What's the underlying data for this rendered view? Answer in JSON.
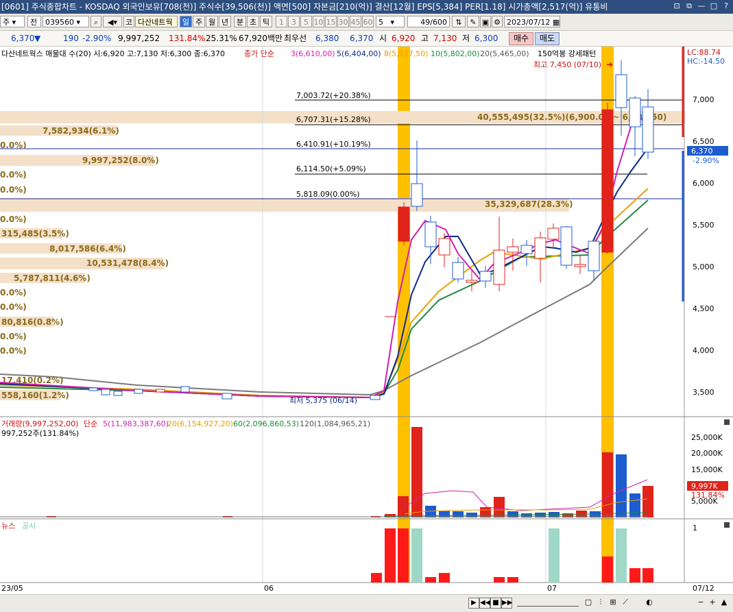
{
  "titlebar": {
    "title": "[0601] 주식종합차트 - KOSDAQ 외국인보유[708(천)] 주식수[39,506(천)] 액면[500] 자본금[210(억)] 결산[12월] EPS[5,384] PER[1.18] 시가총액[2,517(억)] 유통비",
    "buttons": [
      "⊡",
      "⧉",
      "—",
      "□",
      "?"
    ]
  },
  "toolbar": {
    "mode": "주",
    "period_sel": "전",
    "code": "039560",
    "search_icon": "magnifier-icon",
    "c_label": "코",
    "name": "다산네트웍",
    "period_tabs": [
      "일",
      "주",
      "월",
      "년",
      "분",
      "초",
      "틱"
    ],
    "period_selected": "일",
    "minute_options": [
      "1",
      "3",
      "5",
      "10",
      "15",
      "30",
      "45",
      "60"
    ],
    "interval_value": "5",
    "count_value": "49",
    "count_total": "/600",
    "date": "2023/07/12"
  },
  "quote": {
    "price": "6,370",
    "arrow": "▼",
    "change": "190",
    "change_pct": "-2.90%",
    "volume": "9,997,252",
    "vol_ratio": "131.84%",
    "turnover": "25.31%",
    "amount": "67,920백만",
    "pref_label": "최우선",
    "bid": "6,380",
    "ask": "6,370",
    "open_label": "시",
    "open": "6,920",
    "high_label": "고",
    "high": "7,130",
    "low_label": "저",
    "low": "6,300",
    "buy_label": "매수",
    "sell_label": "매도"
  },
  "legend_price": {
    "title": "다산네트웍스 매물대 수(20) 시:6,920 고:7,130 저:6,300 종:6,370",
    "ma_title": "종가 단순",
    "ma3": "3(6,610,00)",
    "ma5": "5(6,404,00)",
    "ma8": "8(5,937,50)",
    "ma10": "10(5,802,00)",
    "ma20": "20(5,465,00)",
    "pattern": "150억봉 강세패턴"
  },
  "right_info": {
    "lc": "LC:88.74",
    "hc": "HC:-14.50"
  },
  "annotations": {
    "high_marker": "최고 7,450 (07/10)",
    "low_marker": "최저 5,375 (06/14)",
    "retrace_levels": [
      "7,003.72(+20.38%)",
      "6,707.31(+15.28%)",
      "6,410.91(+10.19%)",
      "6,114.50(+5.09%)",
      "5,818.09(0.00%)"
    ],
    "volume_profile_big": [
      "40,555,495(32.5%)(6,900.00 ~ 6,724.50)",
      "35,329,687(28.3%)"
    ],
    "current_price_box": "6,370",
    "current_change_box": "-2.90%"
  },
  "volume_profile_labels": [
    "7,582,934(6.1%)",
    "9,997,252(8.0%)",
    "315,485(3.5%)",
    "8,017,586(6.4%)",
    "10,531,478(8.4%)",
    "5,787,811(4.6%)",
    "80,816(0.8%)",
    "558,160(1.2%)",
    "0.0%)",
    "0.0%)",
    "0.0%)",
    "0.0%)",
    "0.0%)",
    "0.0%)",
    "0.0%)",
    "0.0%)",
    "17,410(0.2%)"
  ],
  "price_axis": [
    "7,000",
    "6,500",
    "6,000",
    "5,500",
    "5,000",
    "4,500",
    "4,000",
    "3,500"
  ],
  "volume_legend": {
    "title": "거래량(9,997,252,00)",
    "ma_title": "단순",
    "ma5": "5(11,983,387,60)",
    "ma20": "20(6,154,927,20)",
    "ma60": "60(2,096,860,53)",
    "ma120": "120(1,084,965,21)",
    "sub": "997,252주(131.84%)"
  },
  "volume_axis": [
    "25,000K",
    "20,000K",
    "15,000K",
    "10,000K",
    "5,000K"
  ],
  "volume_current": {
    "value": "9,997K",
    "pct": "131.84%"
  },
  "news_legend": {
    "news": "뉴스",
    "notice": "공시"
  },
  "news_axis": "1",
  "date_axis": [
    "23/05",
    "06",
    "07",
    "07/12"
  ],
  "colors": {
    "up": "#e0231b",
    "down": "#1c5ccf",
    "highlight": "#ffc000",
    "ma3": "#d21fb0",
    "ma5": "#0a2a8a",
    "ma8": "#e8a000",
    "ma10": "#1e8a3a",
    "ma20": "#7a7a7a",
    "profile": "#f4e0c8",
    "news": "#ff1a1a",
    "notice": "#a0d8c8"
  }
}
